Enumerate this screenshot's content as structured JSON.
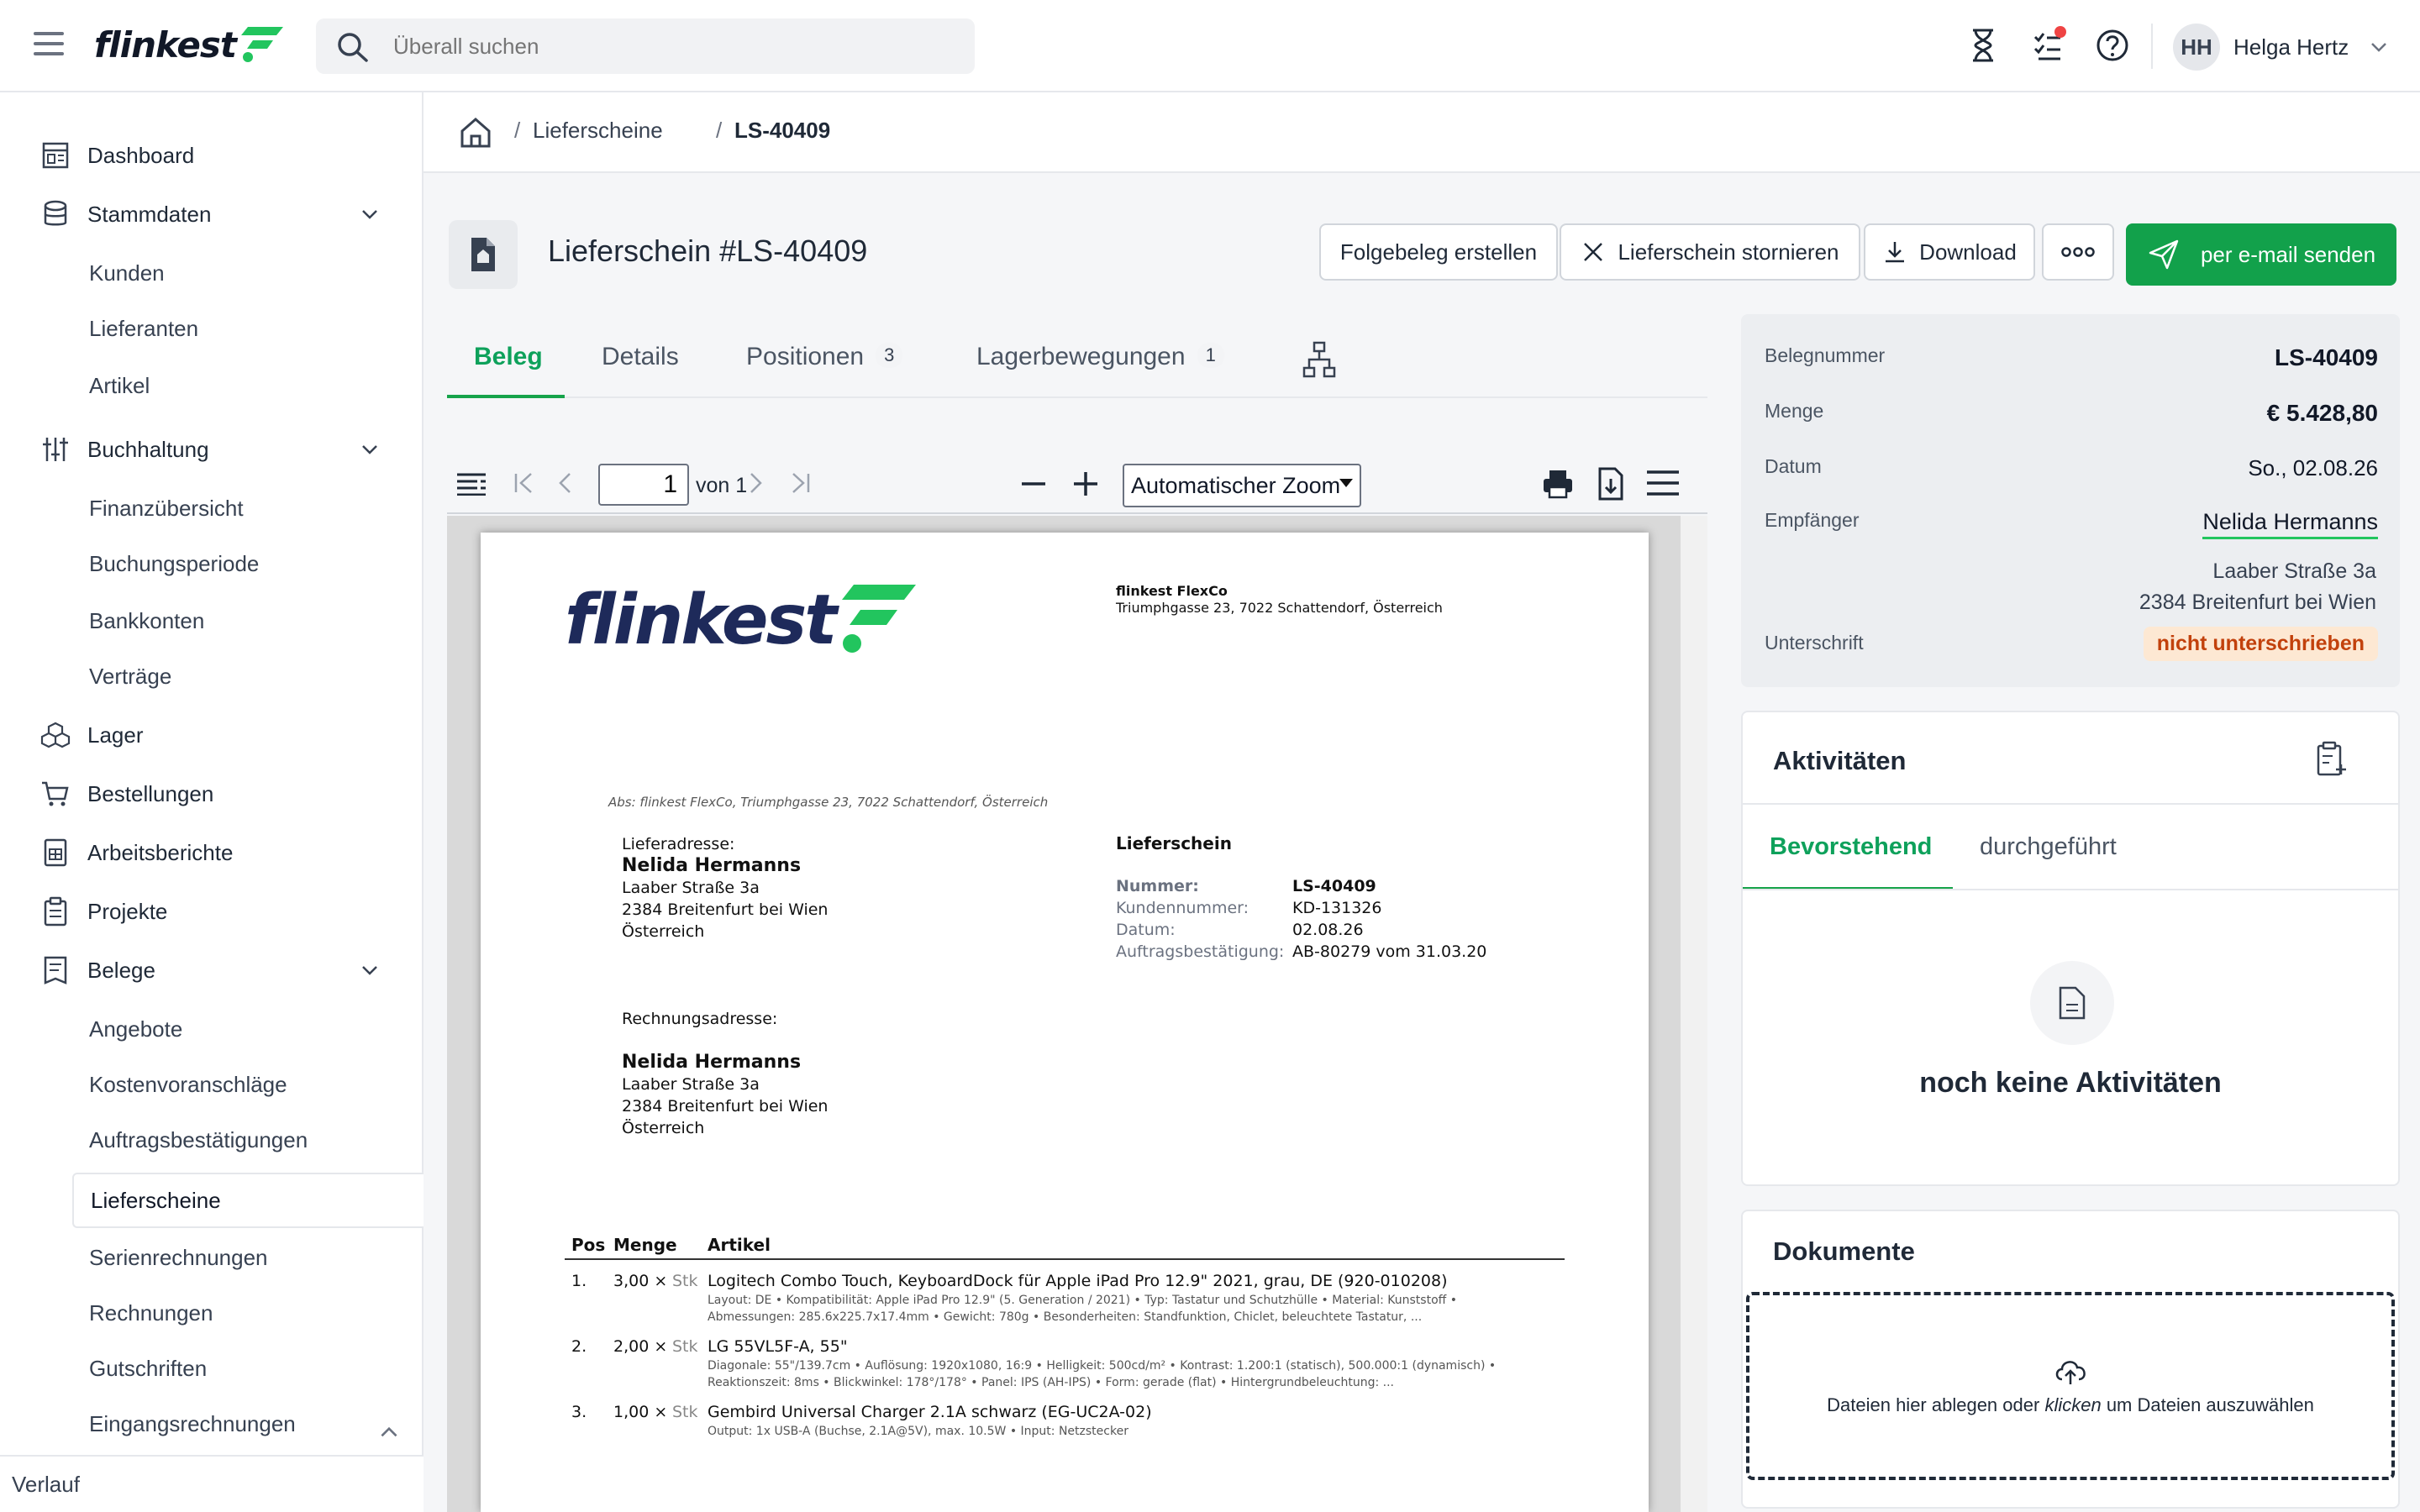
{
  "header": {
    "logo": "flinkest",
    "search_placeholder": "Überall suchen",
    "user_initials": "HH",
    "user_name": "Helga Hertz"
  },
  "sidebar": {
    "items": [
      {
        "label": "Dashboard",
        "icon": "dashboard-icon"
      },
      {
        "label": "Stammdaten",
        "icon": "database-icon",
        "expanded": true,
        "children": [
          "Kunden",
          "Lieferanten",
          "Artikel"
        ]
      },
      {
        "label": "Buchhaltung",
        "icon": "sliders-icon",
        "expanded": true,
        "children": [
          "Finanzübersicht",
          "Buchungsperiode",
          "Bankkonten",
          "Verträge"
        ]
      },
      {
        "label": "Lager",
        "icon": "boxes-icon"
      },
      {
        "label": "Bestellungen",
        "icon": "cart-icon"
      },
      {
        "label": "Arbeitsberichte",
        "icon": "report-icon"
      },
      {
        "label": "Projekte",
        "icon": "clipboard-icon"
      },
      {
        "label": "Belege",
        "icon": "receipt-icon",
        "expanded": true,
        "children": [
          "Angebote",
          "Kostenvoranschläge",
          "Auftragsbestätigungen",
          "Lieferscheine",
          "Serienrechnungen",
          "Rechnungen",
          "Gutschriften",
          "Eingangsrechnungen"
        ]
      }
    ],
    "active": "Lieferscheine",
    "footer": "Verlauf"
  },
  "breadcrumb": {
    "sep": "/",
    "items": [
      "Lieferscheine",
      "LS-40409"
    ]
  },
  "page": {
    "title": "Lieferschein #LS-40409",
    "actions": {
      "followup": "Folgebeleg erstellen",
      "cancel": "Lieferschein stornieren",
      "download": "Download",
      "send": "per e-mail senden"
    },
    "tabs": [
      {
        "label": "Beleg",
        "active": true
      },
      {
        "label": "Details"
      },
      {
        "label": "Positionen",
        "badge": "3"
      },
      {
        "label": "Lagerbewegungen",
        "badge": "1"
      }
    ]
  },
  "viewer": {
    "page": "1",
    "of": "von 1",
    "zoom": "Automatischer Zoom"
  },
  "document": {
    "logo": "flinkest",
    "company": "flinkest FlexCo",
    "company_address": "Triumphgasse 23, 7022 Schattendorf, Österreich",
    "sender_line": "Abs: flinkest FlexCo, Triumphgasse 23, 7022 Schattendorf, Österreich",
    "delivery_label": "Lieferadresse:",
    "billing_label": "Rechnungsadresse:",
    "recipient_name": "Nelida Hermanns",
    "street": "Laaber Straße 3a",
    "city": "2384 Breitenfurt bei Wien",
    "country": "Österreich",
    "doc_type": "Lieferschein",
    "meta": [
      {
        "k": "Nummer:",
        "v": "LS-40409"
      },
      {
        "k": "Kundennummer:",
        "v": "KD-131326"
      },
      {
        "k": "Datum:",
        "v": "02.08.26"
      },
      {
        "k": "Auftragsbestätigung:",
        "v": "AB-80279 vom 31.03.20"
      }
    ],
    "table_headers": [
      "Pos",
      "Menge",
      "Artikel"
    ],
    "positions": [
      {
        "pos": "1.",
        "qty": "3,00 ×",
        "unit": "Stk",
        "title": "Logitech Combo Touch, KeyboardDock für Apple iPad Pro 12.9\" 2021, grau, DE (920-010208)",
        "desc1": "Layout: DE • Kompatibilität: Apple iPad Pro 12.9\" (5. Generation / 2021) • Typ: Tastatur und Schutzhülle • Material: Kunststoff •",
        "desc2": "Abmessungen: 285.6x225.7x17.4mm • Gewicht: 780g • Besonderheiten: Standfunktion, Chiclet, beleuchtete Tastatur, ..."
      },
      {
        "pos": "2.",
        "qty": "2,00 ×",
        "unit": "Stk",
        "title": "LG 55VL5F-A, 55\"",
        "desc1": "Diagonale: 55\"/139.7cm • Auflösung: 1920x1080, 16:9 • Helligkeit: 500cd/m² • Kontrast: 1.200:1 (statisch), 500.000:1 (dynamisch) •",
        "desc2": "Reaktionszeit: 8ms • Blickwinkel: 178°/178° • Panel: IPS (AH-IPS) • Form: gerade (flat) • Hintergrundbeleuchtung: ..."
      },
      {
        "pos": "3.",
        "qty": "1,00 ×",
        "unit": "Stk",
        "title": "Gembird Universal Charger 2.1A schwarz (EG-UC2A-02)",
        "desc1": "Output: 1x USB-A (Buchse, 2.1A@5V), max. 10.5W • Input: Netzstecker",
        "desc2": ""
      }
    ]
  },
  "info_panel": {
    "rows": [
      {
        "k": "Belegnummer",
        "v": "LS-40409"
      },
      {
        "k": "Menge",
        "v": "€ 5.428,80"
      },
      {
        "k": "Datum",
        "v": "So., 02.08.26"
      },
      {
        "k": "Empfänger",
        "v": "Nelida Hermanns"
      }
    ],
    "address1": "Laaber Straße 3a",
    "address2": "2384 Breitenfurt bei Wien",
    "signature_label": "Unterschrift",
    "signature_status": "nicht unterschrieben"
  },
  "activities": {
    "title": "Aktivitäten",
    "tabs": [
      "Bevorstehend",
      "durchgeführt"
    ],
    "empty": "noch keine Aktivitäten"
  },
  "documents": {
    "title": "Dokumente",
    "drop_pre": "Dateien hier ablegen oder",
    "drop_click": "klicken",
    "drop_post": "um Dateien auszuwählen"
  },
  "colors": {
    "accent": "#12a14b",
    "tab_active": "#0ea15b",
    "warning_bg": "#fde8d3",
    "warning_text": "#c2410c"
  }
}
